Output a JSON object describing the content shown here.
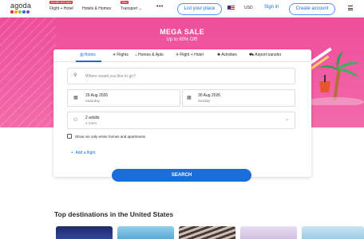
{
  "header": {
    "logo_text": "agoda",
    "logo_dot_colors": [
      "#e12d2d",
      "#f5a623",
      "#8cc63f",
      "#1a6edb",
      "#7b3fe4"
    ],
    "nav": [
      {
        "label": "Flight + Hotel",
        "badge": "Bundle and save"
      },
      {
        "label": "Hotels & Homes",
        "badge": ""
      },
      {
        "label": "Transport",
        "badge": "New"
      }
    ],
    "more_icon": "more-dots-icon",
    "list_place": "List your place",
    "currency": "USD",
    "sign_in": "Sign in",
    "create_account": "Create account"
  },
  "hero": {
    "title": "MEGA SALE",
    "subtitle": "Up to 60% Off!"
  },
  "tabs": [
    {
      "label": "Hotels",
      "icon": "building-icon",
      "active": true
    },
    {
      "label": "Flights",
      "icon": "plane-icon",
      "active": false
    },
    {
      "label": "Homes & Apts",
      "icon": "home-icon",
      "active": false
    },
    {
      "label": "Flight + Hotel",
      "icon": "plane-hotel-icon",
      "active": false
    },
    {
      "label": "Activities",
      "icon": "activities-icon",
      "active": false
    },
    {
      "label": "Airport transfer",
      "icon": "car-icon",
      "active": false
    }
  ],
  "search": {
    "destination_placeholder": "Where would you like to go?",
    "checkin_date": "29 Aug 2026",
    "checkin_day": "Saturday",
    "checkout_date": "30 Aug 2026",
    "checkout_day": "Sunday",
    "guests": "2 adults",
    "rooms": "1 room",
    "homes_only_label": "Show me only entire homes and apartments",
    "add_flight": "Add a flight",
    "search_button": "SEARCH"
  },
  "destinations": {
    "title": "Top destinations in the United States",
    "card_colors": [
      "#2b3a8f",
      "#6ab0d6",
      "#a09a96",
      "#d8c6e6",
      "#9fc9e0"
    ]
  },
  "colors": {
    "accent": "#1a6edb",
    "hero_pink": "#ee4d9b"
  }
}
